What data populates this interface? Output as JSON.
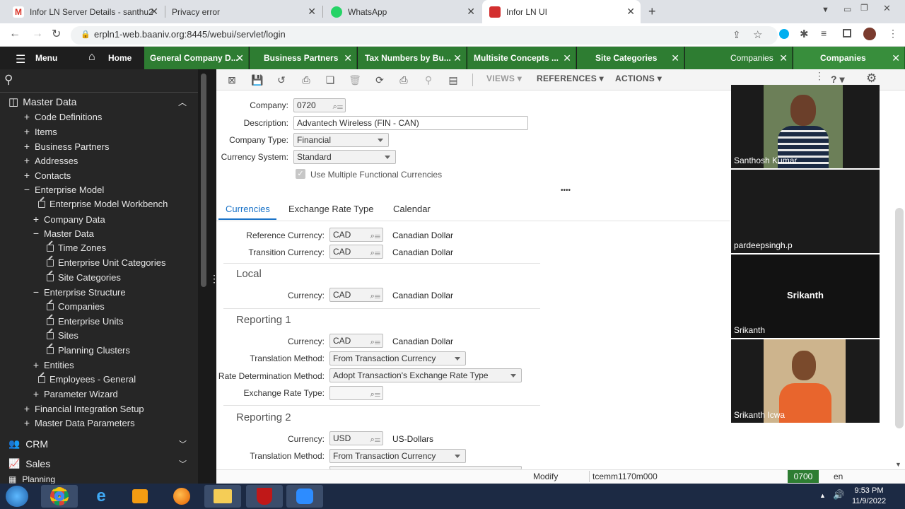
{
  "browser": {
    "tabs": [
      {
        "title": "Infor LN Server Details - santhu2",
        "close": "✕"
      },
      {
        "title": "Privacy error",
        "close": "✕"
      },
      {
        "title": "WhatsApp",
        "close": "✕"
      },
      {
        "title": "Infor LN UI",
        "close": "✕"
      }
    ],
    "new_tab": "+",
    "url": "erpln1-web.baaniv.org:8445/webui/servlet/login"
  },
  "app": {
    "menu_label": "Menu",
    "home_label": "Home",
    "tabs": [
      {
        "label": "General Company D...",
        "close": "✕"
      },
      {
        "label": "Business Partners",
        "close": "✕"
      },
      {
        "label": "Tax Numbers by Bu...",
        "close": "✕"
      },
      {
        "label": "Multisite Concepts ...",
        "close": "✕"
      },
      {
        "label": "Site Categories",
        "close": "✕"
      },
      {
        "label": "Companies",
        "close": "✕"
      },
      {
        "label": "Companies",
        "close": "✕"
      }
    ]
  },
  "sidebar": {
    "section": "Master Data",
    "items": [
      {
        "pm": "+",
        "label": "Code Definitions"
      },
      {
        "pm": "+",
        "label": "Items"
      },
      {
        "pm": "+",
        "label": "Business Partners"
      },
      {
        "pm": "+",
        "label": "Addresses"
      },
      {
        "pm": "+",
        "label": "Contacts"
      },
      {
        "pm": "−",
        "label": "Enterprise Model"
      },
      {
        "pm": "",
        "label": "Enterprise Model Workbench"
      },
      {
        "pm": "+",
        "label": "Company Data"
      },
      {
        "pm": "−",
        "label": "Master Data"
      },
      {
        "pm": "",
        "label": "Time Zones"
      },
      {
        "pm": "",
        "label": "Enterprise Unit Categories"
      },
      {
        "pm": "",
        "label": "Site Categories"
      },
      {
        "pm": "−",
        "label": "Enterprise Structure"
      },
      {
        "pm": "",
        "label": "Companies"
      },
      {
        "pm": "",
        "label": "Enterprise Units"
      },
      {
        "pm": "",
        "label": "Sites"
      },
      {
        "pm": "",
        "label": "Planning Clusters"
      },
      {
        "pm": "+",
        "label": "Entities"
      },
      {
        "pm": "",
        "label": "Employees - General"
      },
      {
        "pm": "+",
        "label": "Parameter Wizard"
      },
      {
        "pm": "+",
        "label": "Financial Integration Setup"
      },
      {
        "pm": "+",
        "label": "Master Data Parameters"
      }
    ],
    "crm": "CRM",
    "sales": "Sales",
    "planning": "Planning"
  },
  "toolbar": {
    "views": "VIEWS",
    "references": "REFERENCES",
    "actions": "ACTIONS",
    "help": "?"
  },
  "form": {
    "company_label": "Company:",
    "company_value": "0720",
    "description_label": "Description:",
    "description_value": "Advantech Wireless (FIN - CAN)",
    "company_type_label": "Company Type:",
    "company_type_value": "Financial",
    "currency_system_label": "Currency System:",
    "currency_system_value": "Standard",
    "multi_currency_label": "Use Multiple Functional Currencies",
    "more": "••••"
  },
  "subtabs": [
    "Currencies",
    "Exchange Rate Type",
    "Calendar"
  ],
  "currencies": {
    "reference_label": "Reference Currency:",
    "reference_value": "CAD",
    "reference_desc": "Canadian Dollar",
    "transition_label": "Transition Currency:",
    "transition_value": "CAD",
    "transition_desc": "Canadian Dollar",
    "local_title": "Local",
    "local_label": "Currency:",
    "local_value": "CAD",
    "local_desc": "Canadian Dollar",
    "rep1_title": "Reporting 1",
    "rep1_currency_label": "Currency:",
    "rep1_currency_value": "CAD",
    "rep1_currency_desc": "Canadian Dollar",
    "rep1_translation_label": "Translation Method:",
    "rep1_translation_value": "From Transaction Currency",
    "rep1_rate_label": "Rate Determination Method:",
    "rep1_rate_value": "Adopt Transaction's Exchange Rate Type",
    "rep1_ert_label": "Exchange Rate Type:",
    "rep2_title": "Reporting 2",
    "rep2_currency_label": "Currency:",
    "rep2_currency_value": "USD",
    "rep2_currency_desc": "US-Dollars",
    "rep2_translation_label": "Translation Method:",
    "rep2_translation_value": "From Transaction Currency"
  },
  "status": {
    "mode": "Modify",
    "session": "tcemm1170m000",
    "company": "0700",
    "lang": "en"
  },
  "video": {
    "participants": [
      "Santhosh Kumar",
      "pardeepsingh.p",
      "Srikanth",
      "Srikanth Icwa"
    ],
    "center_name": "Srikanth"
  },
  "taskbar": {
    "time": "9:53 PM",
    "date": "11/9/2022"
  },
  "colors": {
    "app_green": "#2e7d32",
    "active_blue": "#1a73c8",
    "sidebar_bg": "#262626"
  }
}
